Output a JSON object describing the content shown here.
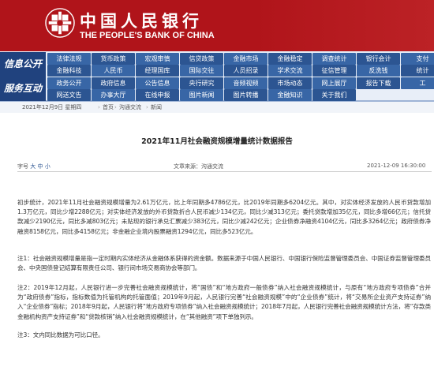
{
  "header": {
    "bank_name_cn": "中国人民银行",
    "bank_name_en": "THE PEOPLE'S BANK OF CHINA"
  },
  "nav": {
    "side_labels": [
      "信息公开",
      "服务互动"
    ],
    "row1": [
      "法律法规",
      "货币政策",
      "宏观审慎",
      "信贷政策",
      "金融市场",
      "金融稳定",
      "调查统计",
      "银行会计",
      "支付"
    ],
    "row2": [
      "金融科技",
      "人民币",
      "经理国库",
      "国际交往",
      "人员招录",
      "学术交流",
      "征信管理",
      "反洗钱",
      "统计"
    ],
    "row3": [
      "政务公开",
      "政府信息",
      "公告信息",
      "央行研究",
      "音频视频",
      "市场动态",
      "网上展厅",
      "报告下载",
      "工"
    ],
    "row4": [
      "网送文告",
      "办事大厅",
      "在线申报",
      "图片新闻",
      "图片转播",
      "金融知识",
      "关于我们",
      "",
      ""
    ]
  },
  "breadcrumb": {
    "date": "2021年12月9日 星期四",
    "path": [
      "首页",
      "沟通交流",
      "新闻"
    ]
  },
  "article": {
    "title": "2021年11月社会融资规模增量统计数据报告",
    "font_size_label": "字号",
    "font_sizes": [
      "大",
      "中",
      "小"
    ],
    "source": "文章来源：沟通交流",
    "date": "2021-12-09 16:30:00",
    "paragraphs": [
      "初步统计，2021年11月社会融资规模增量为2.61万亿元，比上年同期多4786亿元，比2019年同期多6204亿元。其中，对实体经济发放的人民币贷款增加1.3万亿元，同比少增2288亿元；对实体经济发放的外币贷款折合人民币减少134亿元，同比少减313亿元；委托贷款增加35亿元，同比多增66亿元；信托贷款减少2190亿元，同比多减803亿元；未贴现的银行承兑汇票减少383亿元，同比少减242亿元；企业债券净融资4104亿元，同比多3264亿元；政府债券净融资8158亿元，同比多4158亿元；非金融企业境内股票融资1294亿元，同比多523亿元。",
      "注1：社会融资规模增量是指一定时期内实体经济从金融体系获得的资金额。数据来源于中国人民银行、中国银行保险监督管理委员会、中国证券监督管理委员会、中央国债登记结算有限责任公司、银行间市场交易商协会等部门。",
      "注2：2019年12月起，人民银行进一步完善社会融资规模统计，将“国债”和“地方政府一般债券”纳入社会融资规模统计，与原有“地方政府专项债券”合并为“政府债券”指标，指标数值为托管机构的托管面值；2019年9月起，人民银行完善“社会融资规模”中的“企业债券”统计，将“交易所企业资产支持证券”纳入“企业债券”指标；2018年9月起，人民银行将“地方政府专项债券”纳入社会融资规模统计；2018年7月起，人民银行完善社会融资规模统计方法，将“存款类金融机构资产支持证券”和“贷款核销”纳入社会融资规模统计，在“其他融资”项下单独列示。",
      "注3：文内同比数据为可比口径。"
    ]
  }
}
